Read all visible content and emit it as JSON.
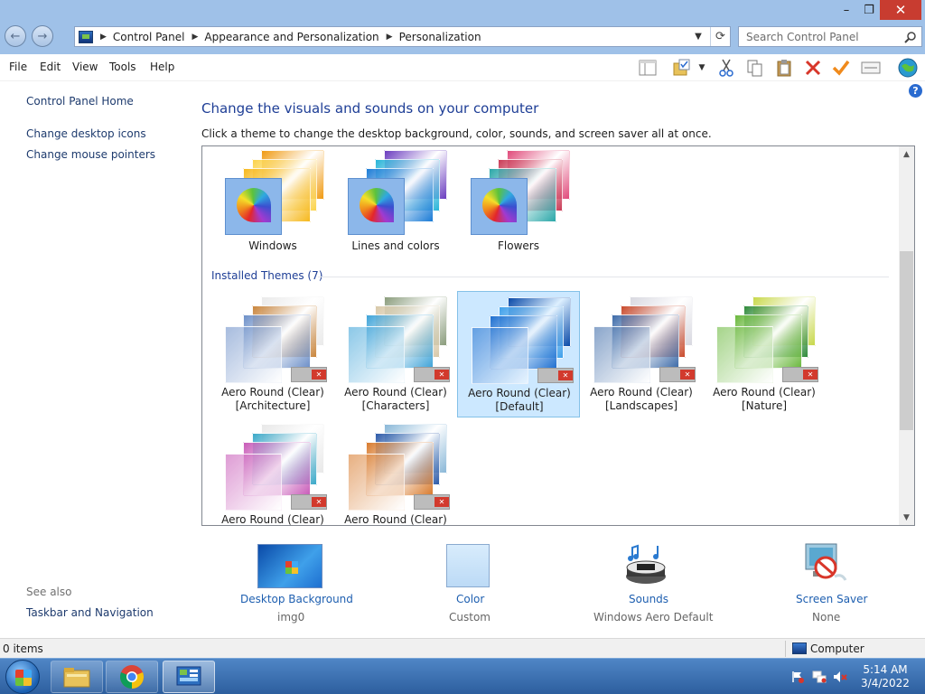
{
  "window": {
    "title_buttons": {
      "minimize": "–",
      "maximize": "❐",
      "close": "✕"
    }
  },
  "address": {
    "crumbs": [
      "Control Panel",
      "Appearance and Personalization",
      "Personalization"
    ],
    "search_placeholder": "Search Control Panel"
  },
  "menu": [
    "File",
    "Edit",
    "View",
    "Tools",
    "Help"
  ],
  "toolbar_icons": [
    "layout-icon",
    "folder-check-icon",
    "dropdown-arrow-icon",
    "cut-icon",
    "copy-icon",
    "paste-icon",
    "delete-icon",
    "checkmark-icon",
    "properties-icon",
    "globe-icon"
  ],
  "sidebar": {
    "home": "Control Panel Home",
    "links": [
      "Change desktop icons",
      "Change mouse pointers"
    ],
    "see_also_heading": "See also",
    "see_also_links": [
      "Taskbar and Navigation"
    ]
  },
  "main": {
    "title": "Change the visuals and sounds on your computer",
    "description": "Click a theme to change the desktop background, color, sounds, and screen saver all at once."
  },
  "themes": {
    "windows_themes": [
      {
        "name": "Windows",
        "colors": [
          "#f6b81c",
          "#fbd34a",
          "#f09a12"
        ]
      },
      {
        "name": "Lines and colors",
        "colors": [
          "#1a7bd6",
          "#27b4d8",
          "#6a3cbf"
        ]
      },
      {
        "name": "Flowers",
        "colors": [
          "#2aa7a8",
          "#c93a55",
          "#e04a7a"
        ]
      }
    ],
    "installed_heading": "Installed Themes (7)",
    "installed": [
      {
        "name": "Aero Round (Clear)",
        "variant": "[Architecture]",
        "colors": [
          "#6c8fc8",
          "#c9853c",
          "#eaeaea"
        ],
        "selected": false
      },
      {
        "name": "Aero Round (Clear)",
        "variant": "[Characters]",
        "colors": [
          "#3ea3d8",
          "#d8c8a8",
          "#8a9c7c"
        ],
        "selected": false
      },
      {
        "name": "Aero Round (Clear)",
        "variant": "[Default]",
        "colors": [
          "#1e6fd0",
          "#3fa0ea",
          "#0a4aa8"
        ],
        "selected": true
      },
      {
        "name": "Aero Round (Clear)",
        "variant": "[Landscapes]",
        "colors": [
          "#3c6aa8",
          "#c94a2c",
          "#d8d8e0"
        ],
        "selected": false
      },
      {
        "name": "Aero Round (Clear)",
        "variant": "[Nature]",
        "colors": [
          "#6ab83c",
          "#2f8a3a",
          "#c8d84a"
        ],
        "selected": false
      },
      {
        "name": "Aero Round (Clear)",
        "variant": "",
        "colors": [
          "#c85ab8",
          "#3aa8c8",
          "#e8e8e8"
        ],
        "selected": false
      },
      {
        "name": "Aero Round (Clear)",
        "variant": "",
        "colors": [
          "#d87a2c",
          "#2c5aa8",
          "#8ab8d8"
        ],
        "selected": false
      }
    ]
  },
  "options": [
    {
      "title": "Desktop Background",
      "sub": "img0",
      "icon": "desktop-background-icon"
    },
    {
      "title": "Color",
      "sub": "Custom",
      "icon": "color-swatch-icon"
    },
    {
      "title": "Sounds",
      "sub": "Windows Aero Default",
      "icon": "sounds-icon"
    },
    {
      "title": "Screen Saver",
      "sub": "None",
      "icon": "screen-saver-icon"
    }
  ],
  "status": {
    "items": "0 items",
    "location": "Computer"
  },
  "taskbar": {
    "apps": [
      "file-explorer-icon",
      "chrome-icon",
      "control-panel-icon"
    ],
    "time": "5:14 AM",
    "date": "3/4/2022"
  }
}
